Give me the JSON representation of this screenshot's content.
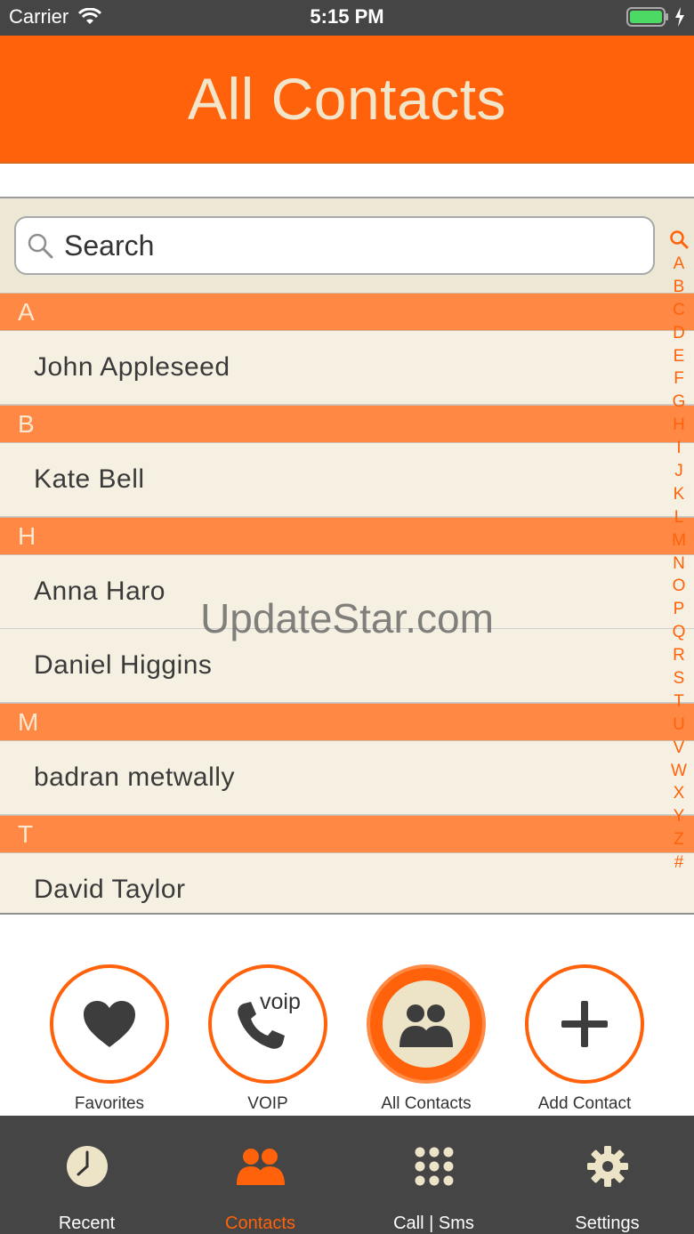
{
  "status_bar": {
    "carrier": "Carrier",
    "time": "5:15 PM"
  },
  "header": {
    "title": "All Contacts"
  },
  "search": {
    "placeholder": "Search"
  },
  "index_letters": [
    "A",
    "B",
    "C",
    "D",
    "E",
    "F",
    "G",
    "H",
    "I",
    "J",
    "K",
    "L",
    "M",
    "N",
    "O",
    "P",
    "Q",
    "R",
    "S",
    "T",
    "U",
    "V",
    "W",
    "X",
    "Y",
    "Z",
    "#"
  ],
  "sections": [
    {
      "letter": "A",
      "contacts": [
        "John Appleseed"
      ]
    },
    {
      "letter": "B",
      "contacts": [
        "Kate Bell"
      ]
    },
    {
      "letter": "H",
      "contacts": [
        "Anna Haro",
        "Daniel Higgins"
      ]
    },
    {
      "letter": "M",
      "contacts": [
        "badran metwally"
      ]
    },
    {
      "letter": "T",
      "contacts": [
        "David Taylor"
      ]
    }
  ],
  "watermark": "UpdateStar.com",
  "actions": {
    "favorites": {
      "label": "Favorites",
      "icon": "heart-icon"
    },
    "voip": {
      "label": "VOIP",
      "icon_text": "voip",
      "icon": "phone-icon"
    },
    "all_contacts": {
      "label": "All Contacts",
      "icon": "people-icon"
    },
    "add_contact": {
      "label": "Add Contact",
      "icon": "plus-icon"
    }
  },
  "tabs": {
    "recent": {
      "label": "Recent",
      "icon": "clock-icon"
    },
    "contacts": {
      "label": "Contacts",
      "icon": "people-icon"
    },
    "call_sms": {
      "label": "Call | Sms",
      "icon": "keypad-icon"
    },
    "settings": {
      "label": "Settings",
      "icon": "gear-icon"
    }
  },
  "colors": {
    "accent": "#ff620a",
    "section_header": "#ff8844",
    "row_background": "#f5f0e1",
    "tabbar": "#454545"
  }
}
